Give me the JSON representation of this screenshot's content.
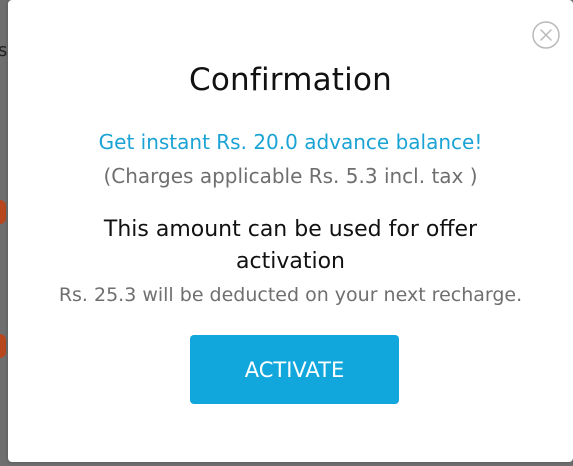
{
  "background": {
    "partial_letter": "s"
  },
  "dialog": {
    "title": "Confirmation",
    "offer_text": "Get instant Rs. 20.0 advance balance!",
    "charges_text": "(Charges applicable Rs. 5.3 incl. tax )",
    "usage_text": "This amount can be used for offer activation",
    "deduct_text": "Rs. 25.3 will be deducted on your next recharge.",
    "activate_label": "ACTIVATE",
    "close_icon": "close-circle-icon"
  },
  "colors": {
    "accent": "#1aa3d4",
    "button": "#11a7dc",
    "muted_text": "#6f6f6f",
    "primary_text": "#111111"
  }
}
